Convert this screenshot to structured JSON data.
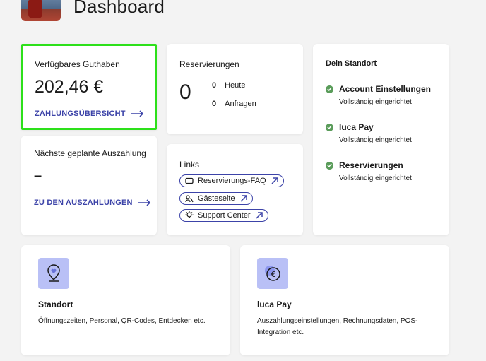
{
  "header": {
    "thumbnail": "location-photo",
    "title": "Dashboard"
  },
  "balance": {
    "label": "Verfügbares Guthaben",
    "amount": "202,46 €",
    "link": "ZAHLUNGSÜBERSICHT"
  },
  "payout": {
    "label": "Nächste geplante Auszahlung",
    "value": "–",
    "link": "ZU DEN AUSZAHLUNGEN"
  },
  "reservations": {
    "label": "Reservierungen",
    "total": "0",
    "today_count": "0",
    "today_label": "Heute",
    "requests_count": "0",
    "requests_label": "Anfragen"
  },
  "links": {
    "label": "Links",
    "items": [
      {
        "label": "Reservierungs-FAQ",
        "icon": "ticket-icon"
      },
      {
        "label": "Gästeseite",
        "icon": "guests-icon"
      },
      {
        "label": "Support Center",
        "icon": "lightbulb-icon"
      }
    ]
  },
  "location": {
    "title": "Dein Standort",
    "items": [
      {
        "title": "Account Einstellungen",
        "status": "Vollständig eingerichtet"
      },
      {
        "title": "luca Pay",
        "status": "Vollständig eingerichtet"
      },
      {
        "title": "Reservierungen",
        "status": "Vollständig eingerichtet"
      }
    ]
  },
  "tiles": {
    "standort": {
      "title": "Standort",
      "description": "Öffnungszeiten, Personal, QR-Codes, Entdecken etc.",
      "icon": "location-pin-icon"
    },
    "lucapay": {
      "title": "luca Pay",
      "description": "Auszahlungseinstellungen, Rechnungsdaten, POS-Integration etc.",
      "icon": "euro-coin-icon"
    }
  },
  "colors": {
    "accent": "#3c43a8",
    "highlight_border": "#2de01a",
    "check": "#5a9c5a",
    "tile_bg": "#b9c0f6",
    "background": "#f3f3f3"
  }
}
